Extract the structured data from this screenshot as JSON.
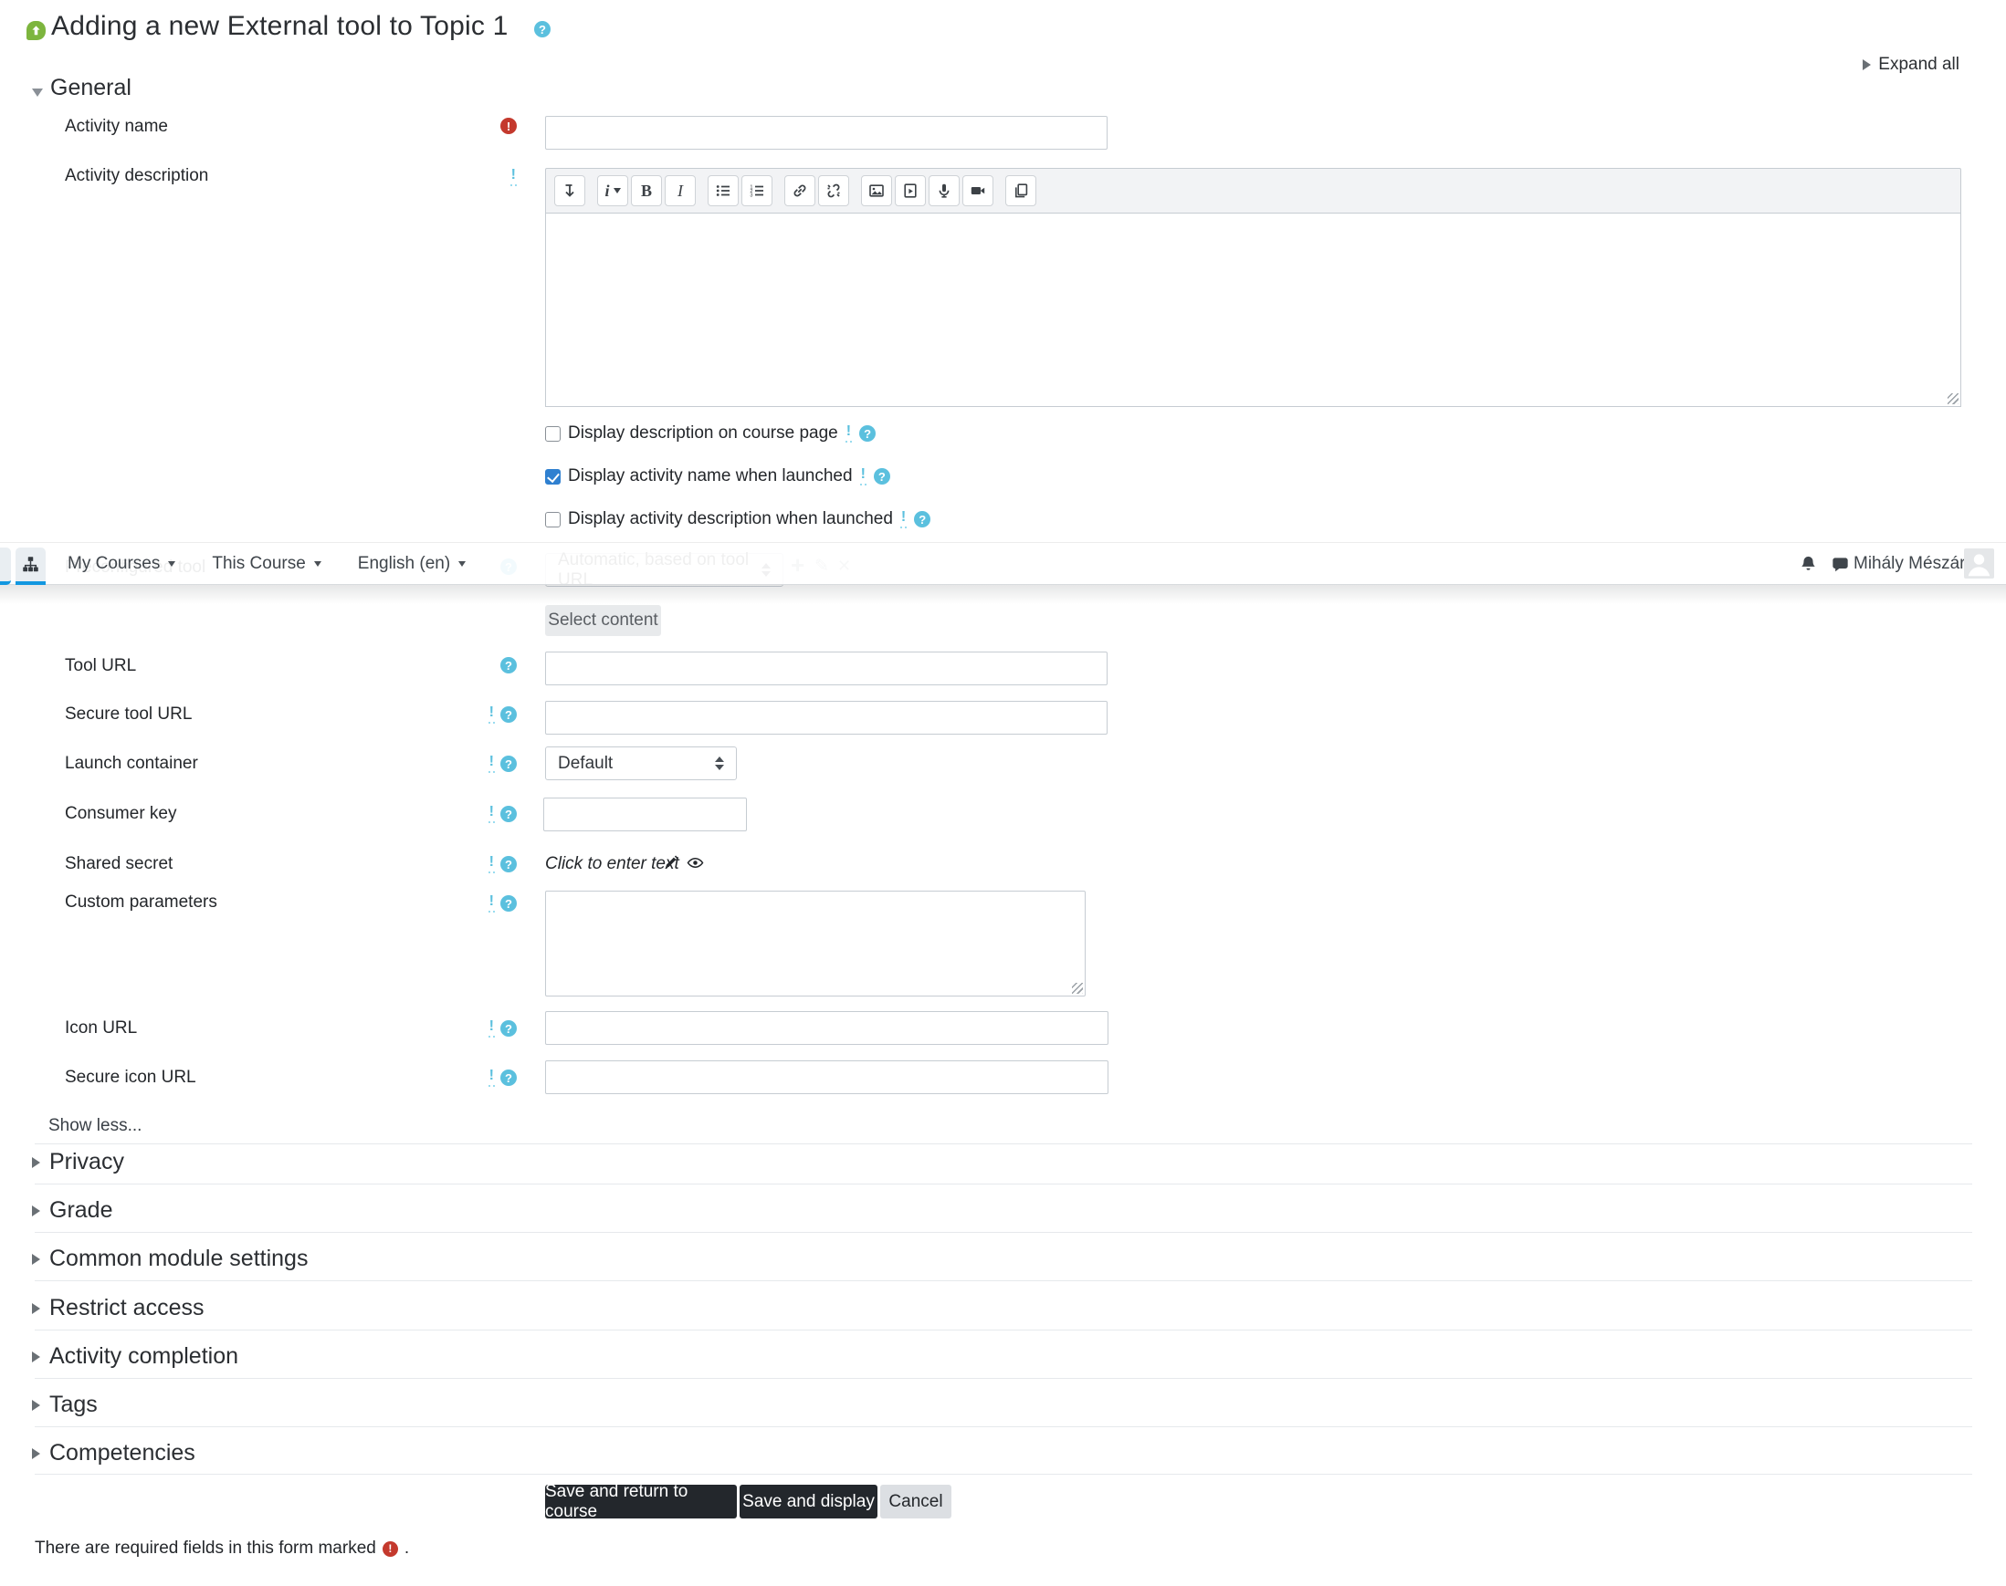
{
  "page": {
    "title": "Adding a new External tool to Topic 1",
    "expand_all_label": "Expand all",
    "required_note": "There are required fields in this form marked",
    "required_note_period": "."
  },
  "navbar": {
    "menus": [
      {
        "label": "My Courses"
      },
      {
        "label": "This Course"
      },
      {
        "label": "English (en)"
      }
    ],
    "user_name": "Mihály Mészáros"
  },
  "general": {
    "heading": "General",
    "activity_name_label": "Activity name",
    "activity_description_label": "Activity description",
    "checkboxes": [
      {
        "label": "Display description on course page",
        "checked": false
      },
      {
        "label": "Display activity name when launched",
        "checked": true
      },
      {
        "label": "Display activity description when launched",
        "checked": false
      }
    ],
    "preconfigured_tool": {
      "label": "Preconfigured tool",
      "value": "Automatic, based on tool URL"
    },
    "select_content_label": "Select content",
    "tool_url_label": "Tool URL",
    "secure_tool_url_label": "Secure tool URL",
    "launch_container_label": "Launch container",
    "launch_container_value": "Default",
    "consumer_key_label": "Consumer key",
    "shared_secret_label": "Shared secret",
    "shared_secret_value": "Click to enter text",
    "custom_parameters_label": "Custom parameters",
    "icon_url_label": "Icon URL",
    "secure_icon_url_label": "Secure icon URL",
    "show_less_label": "Show less..."
  },
  "editor": {
    "styles_glyph": "i",
    "bold_glyph": "B",
    "italic_glyph": "I"
  },
  "collapsed_sections": [
    "Privacy",
    "Grade",
    "Common module settings",
    "Restrict access",
    "Activity completion",
    "Tags",
    "Competencies"
  ],
  "actions": {
    "save_return": "Save and return to course",
    "save_display": "Save and display",
    "cancel": "Cancel"
  },
  "icons": {
    "help_glyph": "?",
    "required_glyph": "!",
    "info_glyph": "!",
    "plus_glyph": "+",
    "edit_glyph": "✎",
    "delete_glyph": "✕"
  },
  "colors": {
    "accent_blue": "#1297e0",
    "info_blue": "#5bc0de",
    "required_red": "#c4392d",
    "checkbox_checked": "#2f80d0",
    "dark_button": "#23272c",
    "activity_icon_green": "#7db53e"
  }
}
